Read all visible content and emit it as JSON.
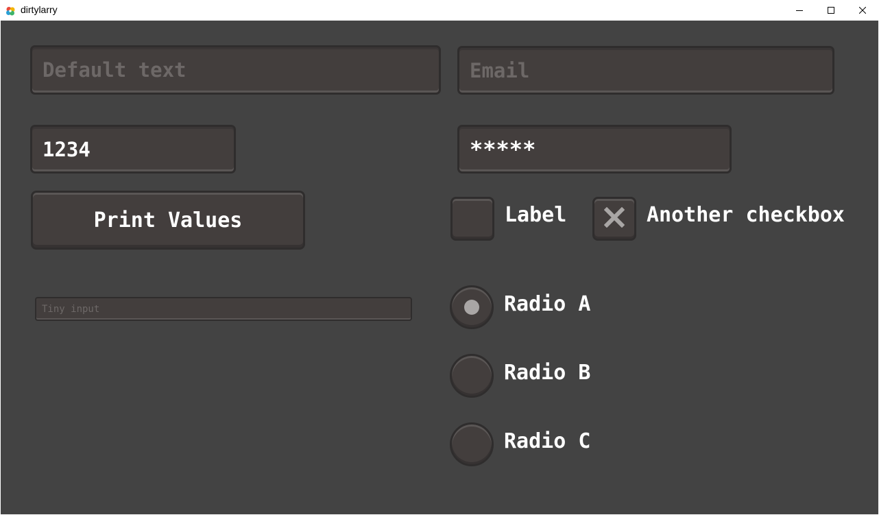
{
  "window": {
    "title": "dirtylarry",
    "icon": "colorful-pinwheel-icon",
    "controls": [
      "minimize-icon",
      "maximize-icon",
      "close-icon"
    ]
  },
  "inputs": {
    "default_text": {
      "value": "",
      "placeholder": "Default text"
    },
    "email": {
      "value": "",
      "placeholder": "Email"
    },
    "number": {
      "value": "1234"
    },
    "password": {
      "value": "*****"
    },
    "tiny": {
      "value": "",
      "placeholder": "Tiny input"
    }
  },
  "button": {
    "label": "Print Values"
  },
  "checkboxes": [
    {
      "label": "Label",
      "checked": false
    },
    {
      "label": "Another checkbox",
      "checked": true
    }
  ],
  "radios": [
    {
      "label": "Radio A",
      "selected": true
    },
    {
      "label": "Radio B",
      "selected": false
    },
    {
      "label": "Radio C",
      "selected": false
    }
  ],
  "colors": {
    "background": "#434343",
    "field": "#433e3d",
    "border": "#2f2d2d",
    "text": "#ffffff",
    "placeholder": "#6d6867",
    "mark": "#a9a6a5"
  }
}
